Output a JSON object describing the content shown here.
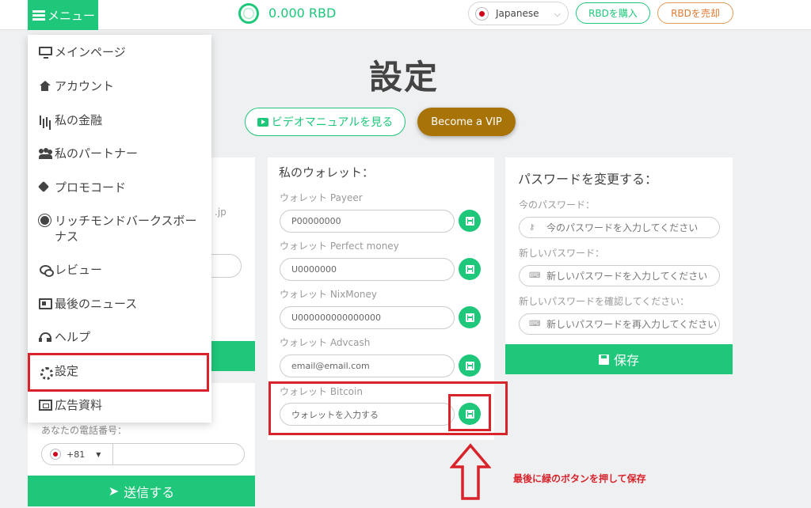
{
  "header": {
    "menu_label": "メニュー",
    "balance": "0.000 RBD",
    "language": "Japanese",
    "buy_label": "RBDを購入",
    "sell_label": "RBDを売却"
  },
  "page": {
    "title": "設定",
    "video_button": "ビデオマニュアルを見る",
    "vip_button": "Become a VIP"
  },
  "menu": {
    "items": [
      {
        "label": "メインページ",
        "icon": "monitor-icon"
      },
      {
        "label": "アカウント",
        "icon": "home-icon"
      },
      {
        "label": "私の金融",
        "icon": "bar-chart-icon"
      },
      {
        "label": "私のパートナー",
        "icon": "users-icon"
      },
      {
        "label": "プロモコード",
        "icon": "tag-icon"
      },
      {
        "label": "リッチモンドバークスボーナス",
        "icon": "certificate-icon"
      },
      {
        "label": "レビュー",
        "icon": "comments-icon"
      },
      {
        "label": "最後のニュース",
        "icon": "newspaper-icon"
      },
      {
        "label": "ヘルプ",
        "icon": "headphones-icon"
      },
      {
        "label": "設定",
        "icon": "gear-icon"
      },
      {
        "label": "広告資料",
        "icon": "sitemap-icon"
      }
    ]
  },
  "left_panel": {
    "partial_text": ".jp",
    "phone_label": "あなたの電話番号：",
    "phone_code": "+81",
    "send_button": "送信する"
  },
  "wallet": {
    "title": "私のウォレット：",
    "fields": [
      {
        "label": "ウォレット Payeer",
        "value": "P00000000"
      },
      {
        "label": "ウォレット Perfect money",
        "value": "U0000000"
      },
      {
        "label": "ウォレット NixMoney",
        "value": "U000000000000000"
      },
      {
        "label": "ウォレット Advcash",
        "value": "email@email.com"
      },
      {
        "label": "ウォレット Bitcoin",
        "placeholder": "ウォレットを入力する"
      }
    ]
  },
  "password": {
    "title": "パスワードを変更する：",
    "current_label": "今のパスワード：",
    "current_placeholder": "今のパスワードを入力してください",
    "new_label": "新しいパスワード：",
    "new_placeholder": "新しいパスワードを入力してください",
    "confirm_label": "新しいパスワードを確認してください：",
    "confirm_placeholder": "新しいパスワードを再入力してください",
    "save_button": "保存"
  },
  "annotation": {
    "text": "最後に緑のボタンを押して保存",
    "color": "#d8232a"
  },
  "colors": {
    "accent": "#1ec77a",
    "vip": "#a87408",
    "sell": "#e07a35"
  }
}
